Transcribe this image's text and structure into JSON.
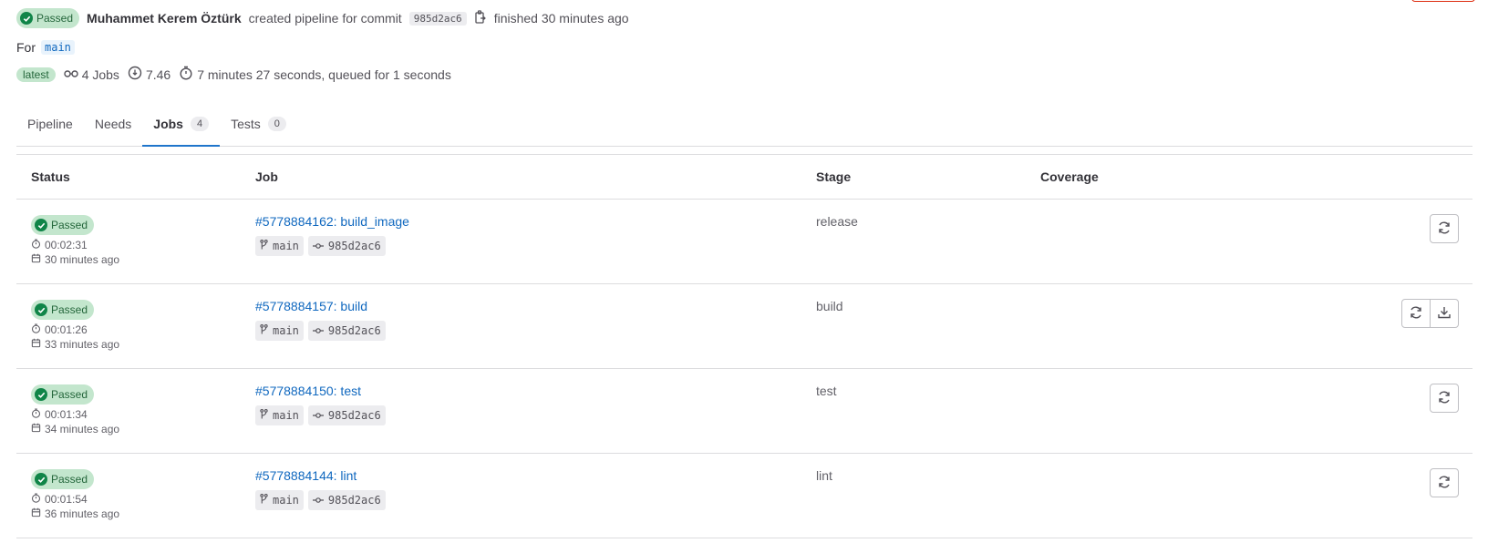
{
  "header": {
    "status": "Passed",
    "author": "Muhammet Kerem Öztürk",
    "action_text": "created pipeline for commit",
    "commit_sha": "985d2ac6",
    "finished_text": "finished 30 minutes ago",
    "for_label": "For",
    "branch": "main",
    "badge": "latest",
    "jobs_text": "4 Jobs",
    "score_text": "7.46",
    "duration_text": "7 minutes 27 seconds, queued for 1 seconds"
  },
  "tabs": [
    {
      "label": "Pipeline",
      "count": null
    },
    {
      "label": "Needs",
      "count": null
    },
    {
      "label": "Jobs",
      "count": "4"
    },
    {
      "label": "Tests",
      "count": "0"
    }
  ],
  "table": {
    "columns": [
      "Status",
      "Job",
      "Stage",
      "Coverage"
    ],
    "rows": [
      {
        "status": "Passed",
        "duration": "00:02:31",
        "time_ago": "30 minutes ago",
        "job": "#5778884162: build_image",
        "branch": "main",
        "sha": "985d2ac6",
        "stage": "release"
      },
      {
        "status": "Passed",
        "duration": "00:01:26",
        "time_ago": "33 minutes ago",
        "job": "#5778884157: build",
        "branch": "main",
        "sha": "985d2ac6",
        "stage": "build"
      },
      {
        "status": "Passed",
        "duration": "00:01:34",
        "time_ago": "34 minutes ago",
        "job": "#5778884150: test",
        "branch": "main",
        "sha": "985d2ac6",
        "stage": "test"
      },
      {
        "status": "Passed",
        "duration": "00:01:54",
        "time_ago": "36 minutes ago",
        "job": "#5778884144: lint",
        "branch": "main",
        "sha": "985d2ac6",
        "stage": "lint"
      }
    ]
  },
  "colors": {
    "success": "#108548",
    "link": "#1068bf",
    "tab_active": "#1f75cb"
  }
}
